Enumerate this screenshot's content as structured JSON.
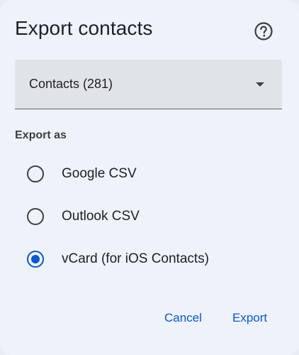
{
  "dialog": {
    "title": "Export contacts",
    "help_icon": "help-circle-icon"
  },
  "source_select": {
    "selected": "Contacts (281)",
    "arrow_icon": "dropdown-arrow-icon"
  },
  "export_as": {
    "label": "Export as",
    "options": [
      {
        "label": "Google CSV",
        "checked": false
      },
      {
        "label": "Outlook CSV",
        "checked": false
      },
      {
        "label": "vCard (for iOS Contacts)",
        "checked": true
      }
    ]
  },
  "actions": {
    "cancel_label": "Cancel",
    "export_label": "Export"
  },
  "colors": {
    "accent": "#0b57d0",
    "background": "#eef2fa",
    "select_fill": "#e0e3e8",
    "text": "#202124"
  }
}
